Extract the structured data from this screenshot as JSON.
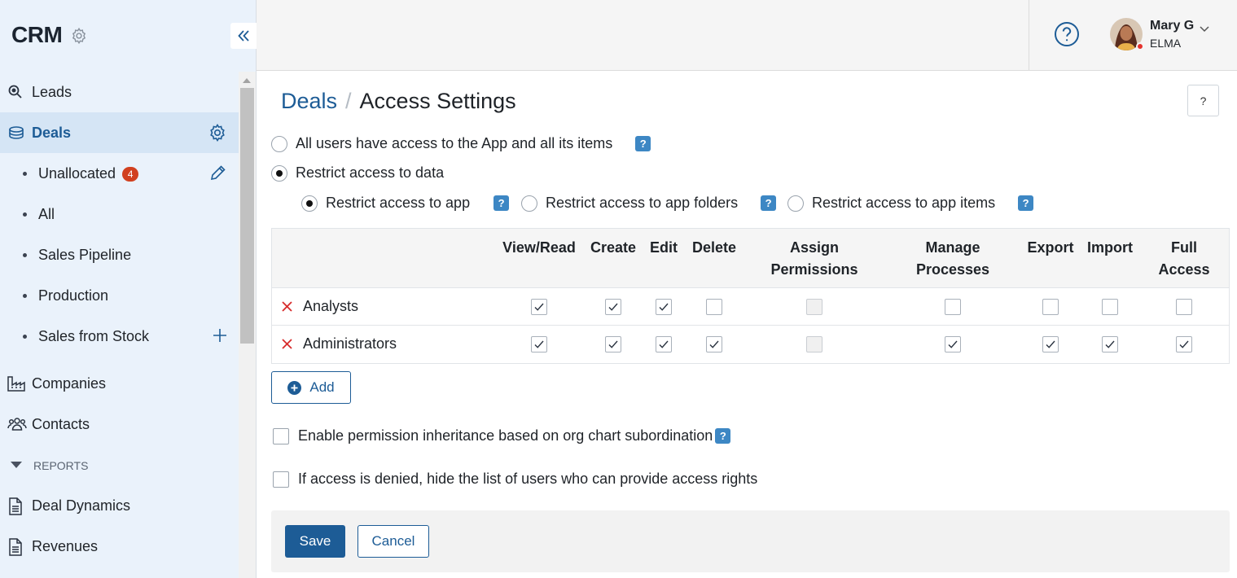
{
  "app": {
    "title": "CRM"
  },
  "sidebar": {
    "items": [
      {
        "label": "Leads",
        "icon": "search-icon"
      },
      {
        "label": "Deals",
        "icon": "stack-icon"
      },
      {
        "label": "Unallocated",
        "badge": "4"
      },
      {
        "label": "All"
      },
      {
        "label": "Sales Pipeline"
      },
      {
        "label": "Production"
      },
      {
        "label": "Sales from Stock"
      },
      {
        "label": "Companies",
        "icon": "factory-icon"
      },
      {
        "label": "Contacts",
        "icon": "people-icon"
      }
    ],
    "section": "REPORTS",
    "reports": [
      {
        "label": "Deal Dynamics",
        "icon": "document-icon"
      },
      {
        "label": "Revenues",
        "icon": "document-icon"
      }
    ]
  },
  "user": {
    "name": "Mary G",
    "org": "ELMA"
  },
  "breadcrumb": {
    "parent": "Deals",
    "separator": "/",
    "current": "Access Settings"
  },
  "page_help": "?",
  "access": {
    "all_users": "All users have access to the App and all its items",
    "restrict": "Restrict access to data",
    "restrict_app": "Restrict access to app",
    "restrict_folders": "Restrict access to app folders",
    "restrict_items": "Restrict access to app items",
    "help_badge": "?"
  },
  "table": {
    "columns": [
      {
        "line1": "View/Read",
        "line2": ""
      },
      {
        "line1": "Create",
        "line2": ""
      },
      {
        "line1": "Edit",
        "line2": ""
      },
      {
        "line1": "Delete",
        "line2": ""
      },
      {
        "line1": "Assign",
        "line2": "Permissions"
      },
      {
        "line1": "Manage",
        "line2": "Processes"
      },
      {
        "line1": "Export",
        "line2": ""
      },
      {
        "line1": "Import",
        "line2": ""
      },
      {
        "line1": "Full",
        "line2": "Access"
      }
    ],
    "rows": [
      {
        "role": "Analysts",
        "perms": [
          true,
          true,
          true,
          false,
          null,
          false,
          false,
          false,
          false
        ]
      },
      {
        "role": "Administrators",
        "perms": [
          true,
          true,
          true,
          true,
          null,
          true,
          true,
          true,
          true
        ]
      }
    ]
  },
  "add_label": "Add",
  "options": {
    "inheritance": "Enable permission inheritance based on org chart subordination",
    "hide_list": "If access is denied, hide the list of users who can provide access rights"
  },
  "footer": {
    "save": "Save",
    "cancel": "Cancel"
  },
  "colors": {
    "accent": "#1d5c96",
    "help_badge": "#3d87c4",
    "danger": "#d72b2b",
    "sidebar_bg": "#eaf2fb"
  }
}
